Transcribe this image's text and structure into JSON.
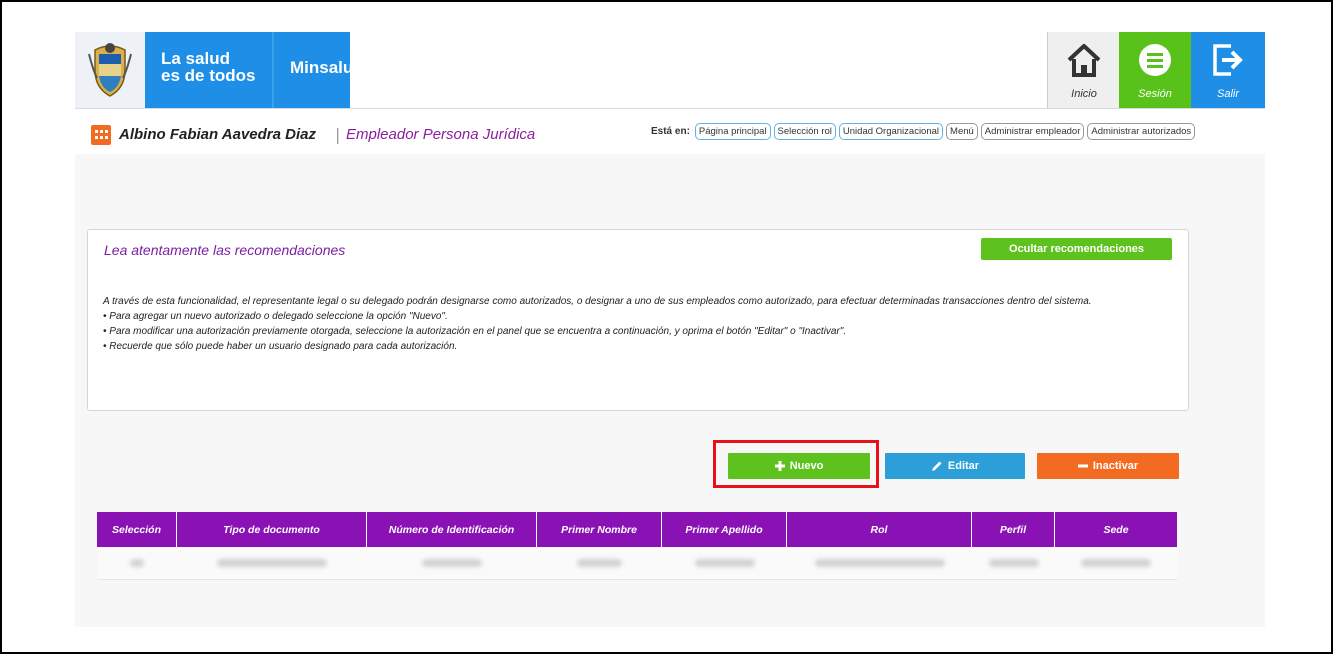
{
  "header": {
    "brand_line": "La salud\nes de todos",
    "ministry": "Minsalud",
    "nav": [
      {
        "label": "Inicio",
        "icon": "home-icon"
      },
      {
        "label": "Sesión",
        "icon": "menu-icon"
      },
      {
        "label": "Salir",
        "icon": "exit-icon"
      }
    ]
  },
  "user": {
    "name": "Albino Fabian Aavedra Diaz",
    "separator": "|",
    "role": "Empleador Persona Jurídica"
  },
  "breadcrumb": {
    "label": "Está en:",
    "items": [
      "Página principal",
      "Selección rol",
      "Unidad Organizacional",
      "Menú",
      "Administrar empleador",
      "Administrar autorizados"
    ]
  },
  "recommendations": {
    "title": "Lea atentamente las recomendaciones",
    "hide_label": "Ocultar recomendaciones",
    "paragraphs": [
      "A través de esta funcionalidad, el representante legal o su delegado podrán designarse como autorizados, o designar a uno de sus empleados como autorizado, para efectuar determinadas transacciones dentro del sistema.",
      "• Para agregar un nuevo autorizado o delegado seleccione la opción \"Nuevo\".",
      "• Para modificar una autorización previamente otorgada, seleccione la autorización en el panel que se encuentra a continuación, y oprima el botón \"Editar\" o \"Inactivar\".",
      "• Recuerde que sólo puede haber un usuario designado para cada autorización."
    ]
  },
  "actions": {
    "nuevo": "Nuevo",
    "editar": "Editar",
    "inactivar": "Inactivar"
  },
  "table": {
    "columns": [
      "Selección",
      "Tipo de documento",
      "Número de Identificación",
      "Primer Nombre",
      "Primer Apellido",
      "Rol",
      "Perfil",
      "Sede"
    ]
  },
  "colors": {
    "brand_blue": "#1e8ee6",
    "green": "#5ec21e",
    "orange": "#f26b21",
    "purple": "#8a12b4",
    "highlight_red": "#e8111a"
  }
}
